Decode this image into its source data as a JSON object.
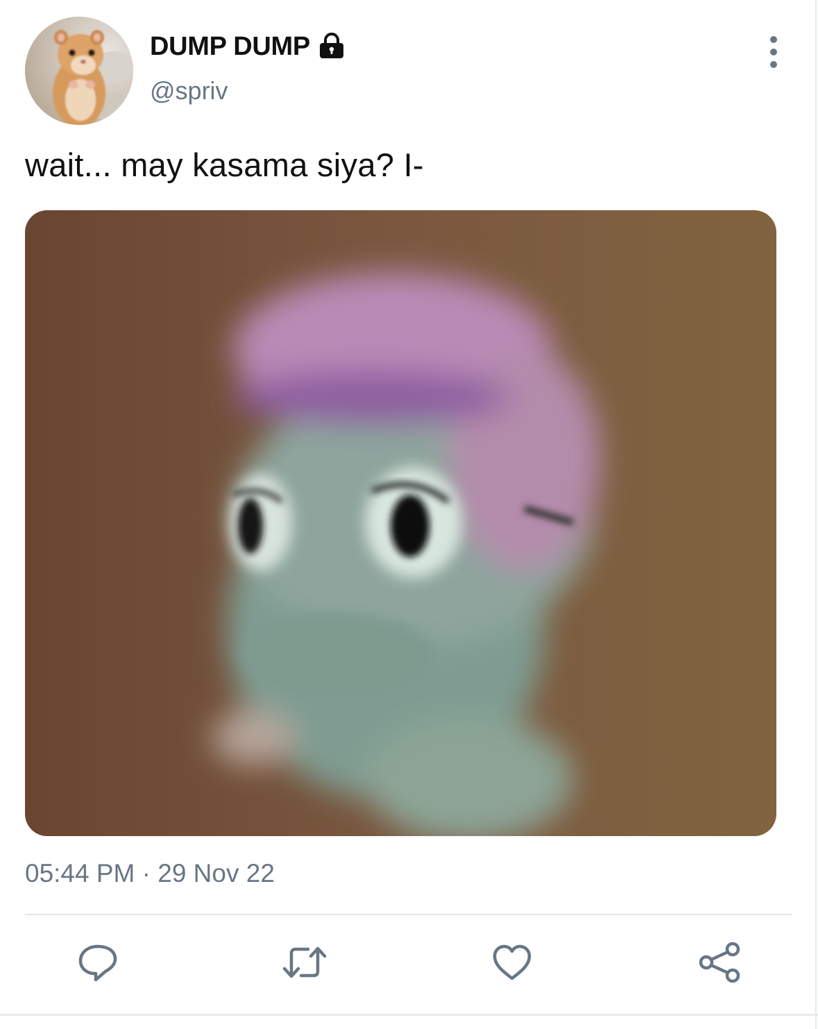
{
  "author": {
    "display_name": "DUMP DUMP",
    "handle": "@spriv",
    "protected_icon": "lock-icon",
    "avatar": "hamster-photo"
  },
  "tweet": {
    "text": "wait... may kasama siya? I-",
    "media": "blurry-cartoon-character-photo",
    "timestamp": "05:44 PM · 29 Nov 22"
  },
  "actions": [
    "reply-icon",
    "retweet-icon",
    "like-icon",
    "share-icon"
  ],
  "menu_icon": "more-vertical-icon",
  "colors": {
    "text": "#111111",
    "secondary": "#687684",
    "divider": "#e1e6ea",
    "media_bg": "#6f4a33"
  }
}
